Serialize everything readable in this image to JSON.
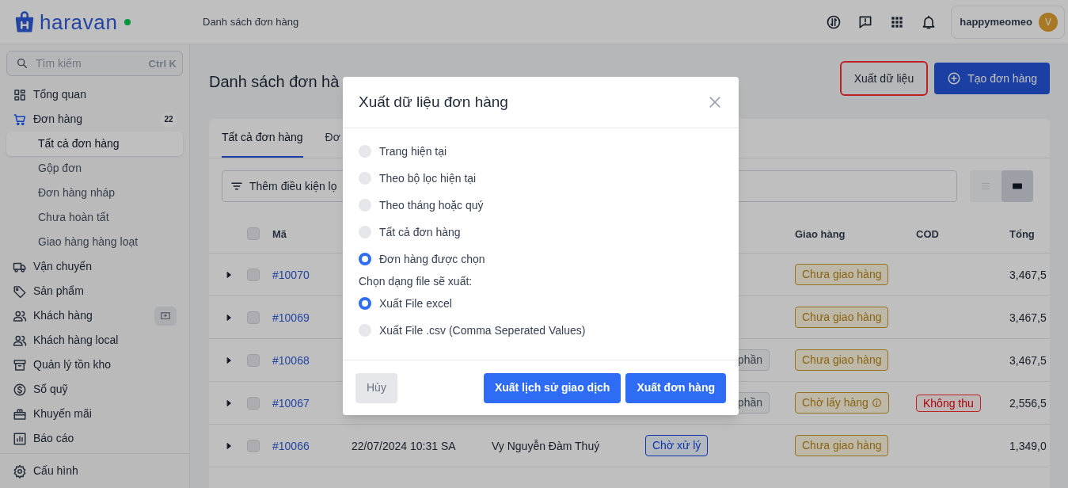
{
  "header": {
    "logo": "haravan",
    "online": true,
    "breadcrumb": "Danh sách đơn hàng",
    "user": {
      "name": "happymeomeo",
      "avatar": "V"
    }
  },
  "sidebar": {
    "search": {
      "placeholder": "Tìm kiếm",
      "shortcut": "Ctrl K"
    },
    "items": [
      {
        "label": "Tổng quan",
        "selected": false
      },
      {
        "label": "Đơn hàng",
        "selected": false,
        "badge": "22",
        "expanded": true,
        "children": [
          {
            "label": "Tất cả đơn hàng",
            "selected": true
          },
          {
            "label": "Gộp đơn",
            "selected": false
          },
          {
            "label": "Đơn hàng nháp",
            "selected": false
          },
          {
            "label": "Chưa hoàn tất",
            "selected": false
          },
          {
            "label": "Giao hàng hàng loạt",
            "selected": false
          }
        ]
      },
      {
        "label": "Vận chuyển",
        "selected": false
      },
      {
        "label": "Sản phẩm",
        "selected": false
      },
      {
        "label": "Khách hàng",
        "selected": false,
        "action_icon": true
      },
      {
        "label": "Khách hàng local",
        "selected": false
      },
      {
        "label": "Quản lý tồn kho",
        "selected": false
      },
      {
        "label": "Sổ quỹ",
        "selected": false
      },
      {
        "label": "Khuyến mãi",
        "selected": false
      },
      {
        "label": "Báo cáo",
        "selected": false
      }
    ],
    "footer_item": {
      "label": "Cấu hình"
    }
  },
  "page": {
    "title": "Danh sách đơn hà",
    "buttons": [
      {
        "label": "Xuất dữ liệu",
        "kind": "secondary",
        "highlighted": true
      },
      {
        "label": "Tạo đơn hàng",
        "kind": "primary"
      }
    ]
  },
  "orders": {
    "tabs": [
      {
        "label": "Tất cả đơn hàng",
        "selected": true
      },
      {
        "label": "Đơ",
        "selected": false
      }
    ],
    "filter": {
      "placeholder": "Thêm điều kiện lọ"
    },
    "view_toggle": [
      {
        "selected": false
      },
      {
        "selected": true
      }
    ],
    "table": {
      "columns": {
        "code": "Mã",
        "shipping": "Giao hàng",
        "cod": "COD",
        "total": "Tổng"
      },
      "select_all_checked": false,
      "rows": [
        {
          "checked": false,
          "code": "#10070",
          "payment": null,
          "shipping": {
            "label": "Chưa giao hàng",
            "info": false
          },
          "cod": null,
          "total": "3,467,5"
        },
        {
          "checked": false,
          "code": "#10069",
          "payment": null,
          "shipping": {
            "label": "Chưa giao hàng",
            "info": false
          },
          "cod": null,
          "total": "3,467,5"
        },
        {
          "checked": false,
          "code": "#10068",
          "payment": {
            "label": "phần",
            "kind": "partial"
          },
          "shipping": {
            "label": "Chưa giao hàng",
            "info": false
          },
          "cod": null,
          "total": "3,467,5"
        },
        {
          "checked": false,
          "code": "#10067",
          "payment": {
            "label": "phần",
            "kind": "partial"
          },
          "shipping": {
            "label": "Chờ lấy hàng",
            "info": true
          },
          "cod": "Không thu",
          "total": "2,556,5"
        },
        {
          "checked": false,
          "code": "#10066",
          "date": "22/07/2024 10:31 SA",
          "customer": "Vy Nguyễn Đàm Thuý",
          "payment": {
            "label": "Chờ xử lý",
            "kind": "pending"
          },
          "shipping": {
            "label": "Chưa giao hàng",
            "info": false
          },
          "cod": null,
          "total": "1,349,0"
        }
      ]
    }
  },
  "modal": {
    "title": "Xuất dữ liệu đơn hàng",
    "scope_options": [
      {
        "label": "Trang hiện tại",
        "selected": false
      },
      {
        "label": "Theo bộ lọc hiện tại",
        "selected": false
      },
      {
        "label": "Theo tháng hoặc quý",
        "selected": false
      },
      {
        "label": "Tất cả đơn hàng",
        "selected": false
      },
      {
        "label": "Đơn hàng được chọn",
        "selected": true
      }
    ],
    "format_label": "Chọn dạng file sẽ xuất:",
    "format_options": [
      {
        "label": "Xuất File excel",
        "selected": true
      },
      {
        "label": "Xuất File .csv (Comma Seperated Values)",
        "selected": false
      }
    ],
    "buttons": [
      {
        "label": "Hủy",
        "kind": "secondary"
      },
      {
        "label": "Xuất lịch sử giao dịch",
        "kind": "primary"
      },
      {
        "label": "Xuất đơn hàng",
        "kind": "primary"
      }
    ]
  }
}
